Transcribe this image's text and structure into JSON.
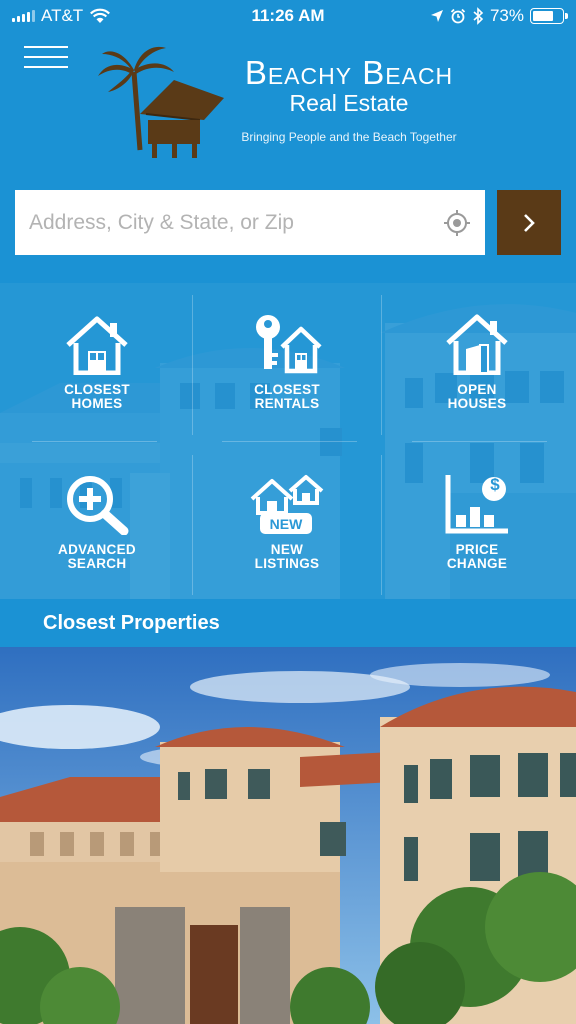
{
  "status_bar": {
    "carrier": "AT&T",
    "time": "11:26 AM",
    "battery": "73%",
    "battery_level": 0.73,
    "icons": [
      "signal-icon",
      "wifi-icon",
      "location-arrow-icon",
      "alarm-icon",
      "bluetooth-icon",
      "battery-icon"
    ]
  },
  "header": {
    "menu_icon": "hamburger-icon",
    "brand_title": "Beachy Beach",
    "brand_subtitle": "Real Estate",
    "tagline": "Bringing People and the Beach Together",
    "logo_icon": "palm-hut-logo"
  },
  "search": {
    "placeholder": "Address, City & State, or Zip",
    "value": "",
    "locate_icon": "crosshair-icon",
    "go_icon": "chevron-right-icon"
  },
  "grid": {
    "tiles": [
      {
        "label_1": "CLOSEST",
        "label_2": "HOMES",
        "icon": "house-icon"
      },
      {
        "label_1": "CLOSEST",
        "label_2": "RENTALS",
        "icon": "key-house-icon"
      },
      {
        "label_1": "OPEN",
        "label_2": "HOUSES",
        "icon": "open-house-icon"
      },
      {
        "label_1": "ADVANCED",
        "label_2": "SEARCH",
        "icon": "magnifier-plus-icon"
      },
      {
        "label_1": "NEW",
        "label_2": "LISTINGS",
        "icon": "new-listings-icon",
        "badge": "NEW"
      },
      {
        "label_1": "PRICE",
        "label_2": "CHANGE",
        "icon": "price-chart-icon",
        "badge_symbol": "$"
      }
    ]
  },
  "section": {
    "title": "Closest Properties"
  },
  "colors": {
    "background": "#1b92d4",
    "brand_brown": "#5a3a17",
    "white": "#ffffff"
  }
}
